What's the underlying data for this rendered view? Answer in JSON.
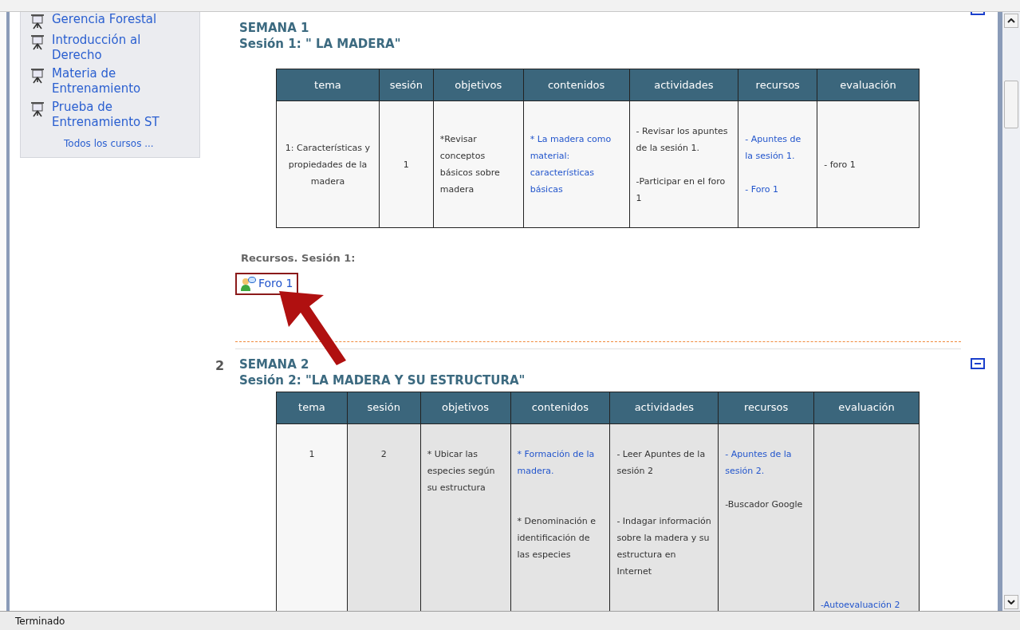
{
  "sidebar": {
    "courses": [
      "Gerencia Forestal",
      "Introducción al Derecho",
      "Materia de Entrenamiento",
      "Prueba de Entrenamiento ST"
    ],
    "all_courses_link": "Todos los cursos ..."
  },
  "sections": [
    {
      "week": "SEMANA 1",
      "session": "Sesión 1: \" LA MADERA\"",
      "columns": [
        "tema",
        "sesión",
        "objetivos",
        "contenidos",
        "actividades",
        "recursos",
        "evaluación"
      ],
      "cells": [
        [
          {
            "kind": "text",
            "text": "1: Características y propiedades de la madera"
          }
        ],
        [
          {
            "kind": "text",
            "text": "1"
          }
        ],
        [
          {
            "kind": "text",
            "text": "*Revisar conceptos básicos sobre madera"
          }
        ],
        [
          {
            "kind": "link",
            "text": "* La madera como material: características básicas"
          }
        ],
        [
          {
            "kind": "text",
            "text": "- Revisar los apuntes de la sesión 1."
          },
          {
            "kind": "break"
          },
          {
            "kind": "text",
            "text": "-Participar en el foro 1"
          }
        ],
        [
          {
            "kind": "link",
            "text": "- Apuntes de la sesión 1."
          },
          {
            "kind": "break"
          },
          {
            "kind": "link",
            "text": "- Foro 1"
          }
        ],
        [
          {
            "kind": "text",
            "text": "- foro 1"
          }
        ]
      ],
      "resources_title": "Recursos. Sesión 1:",
      "resources": [
        {
          "label": "Foro 1",
          "highlighted": true
        }
      ]
    },
    {
      "number": "2",
      "week": "SEMANA 2",
      "session": "Sesión 2: \"LA MADERA Y SU ESTRUCTURA\"",
      "columns": [
        "tema",
        "sesión",
        "objetivos",
        "contenidos",
        "actividades",
        "recursos",
        "evaluación"
      ],
      "cells": [
        [
          {
            "kind": "text",
            "text": "1"
          }
        ],
        [
          {
            "kind": "text",
            "text": "2"
          }
        ],
        [
          {
            "kind": "text",
            "text": "* Ubicar las especies según su estructura"
          }
        ],
        [
          {
            "kind": "link",
            "text": "* Formación de la madera."
          },
          {
            "kind": "break"
          },
          {
            "kind": "break"
          },
          {
            "kind": "text",
            "text": "* Denominación e identificación de las especies"
          }
        ],
        [
          {
            "kind": "text",
            "text": "- Leer Apuntes de la sesión 2"
          },
          {
            "kind": "break"
          },
          {
            "kind": "break"
          },
          {
            "kind": "text",
            "text": "- Indagar información sobre la madera y su estructura en Internet"
          }
        ],
        [
          {
            "kind": "link",
            "text": "- Apuntes de la sesión 2."
          },
          {
            "kind": "break"
          },
          {
            "kind": "text",
            "text": "-Buscador Google"
          }
        ],
        [
          {
            "kind": "break"
          },
          {
            "kind": "break"
          },
          {
            "kind": "break"
          },
          {
            "kind": "break"
          },
          {
            "kind": "break"
          },
          {
            "kind": "break"
          },
          {
            "kind": "break"
          },
          {
            "kind": "break"
          },
          {
            "kind": "break"
          },
          {
            "kind": "link",
            "text": "-Autoevaluación 2"
          }
        ]
      ]
    }
  ],
  "status_bar": "Terminado"
}
